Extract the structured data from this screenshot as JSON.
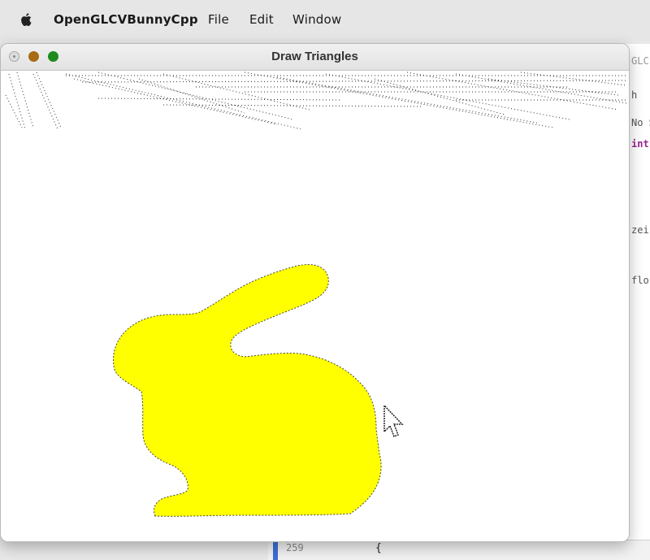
{
  "menubar": {
    "app_name": "OpenGLCVBunnyCpp",
    "items": [
      "File",
      "Edit",
      "Window"
    ]
  },
  "window": {
    "title": "Draw Triangles"
  },
  "background_editor": {
    "snippets": [
      "GLC",
      "h",
      "No S",
      "int",
      "zei)",
      "flo"
    ],
    "line_number": "259",
    "code_fragment": "{"
  },
  "colors": {
    "bunny": "#ffff00",
    "canvas": "#ffffff"
  },
  "icons": {
    "apple": "apple-logo-icon",
    "cursor": "mouse-pointer-icon"
  }
}
